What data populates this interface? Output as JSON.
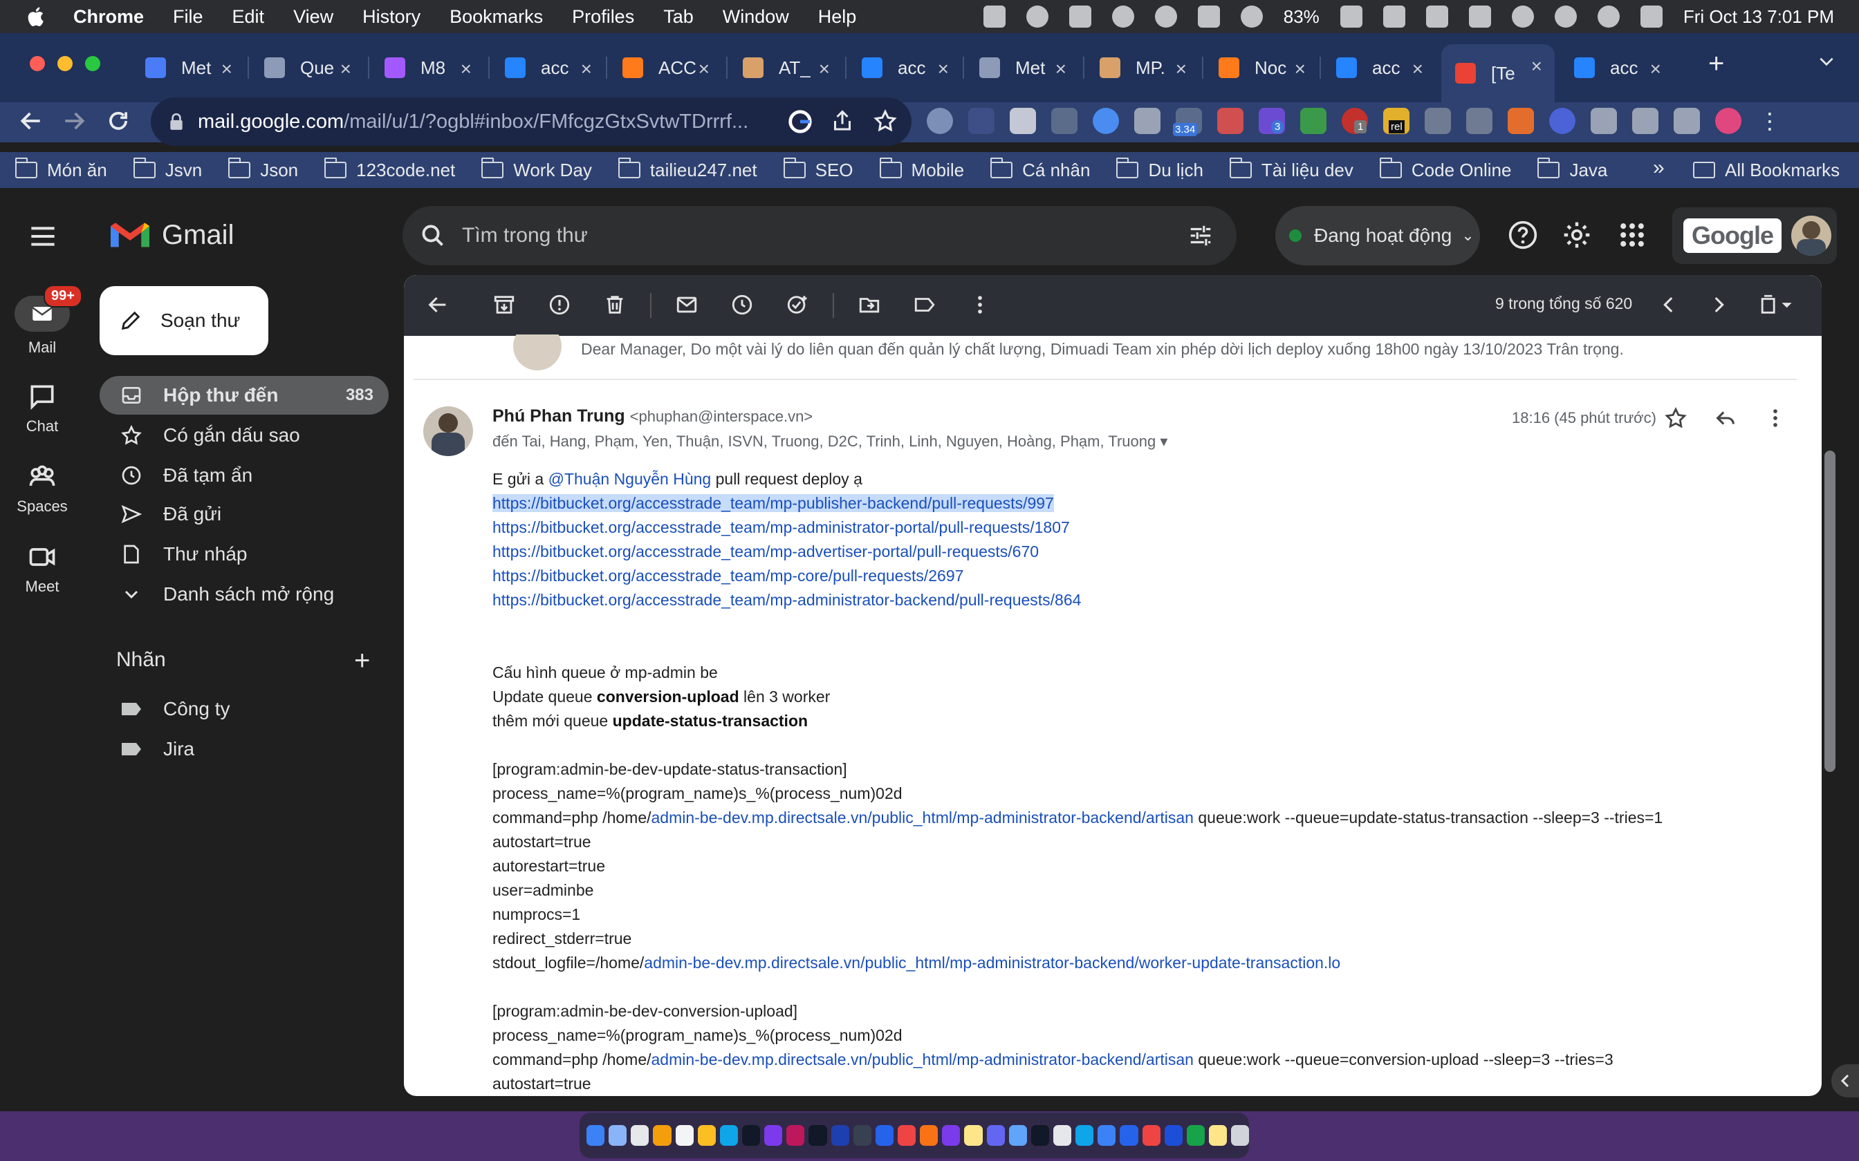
{
  "menubar": {
    "app": "Chrome",
    "items": [
      "File",
      "Edit",
      "View",
      "History",
      "Bookmarks",
      "Profiles",
      "Tab",
      "Window",
      "Help"
    ],
    "battery": "83%",
    "datetime": "Fri Oct 13  7:01 PM"
  },
  "tabs": [
    {
      "title": "Met",
      "color": "#4a7cf7"
    },
    {
      "title": "Que",
      "color": "#8e9bb8"
    },
    {
      "title": "M8",
      "color": "#a259ff"
    },
    {
      "title": "acc",
      "color": "#2684ff"
    },
    {
      "title": "ACC",
      "color": "#ff7a1a"
    },
    {
      "title": "AT_",
      "color": "#d9a06a"
    },
    {
      "title": "acc",
      "color": "#2684ff"
    },
    {
      "title": "Met",
      "color": "#8e9bb8"
    },
    {
      "title": "MP.",
      "color": "#d9a06a"
    },
    {
      "title": "Noc",
      "color": "#ff7a1a"
    },
    {
      "title": "acc",
      "color": "#2684ff"
    },
    {
      "title": "[Te",
      "color": "#ea4335"
    },
    {
      "title": "acc",
      "color": "#2684ff"
    }
  ],
  "omnibox": {
    "host": "mail.google.com",
    "path": "/mail/u/1/?ogbl#inbox/FMfcgzGtxSvtwTDrrrf..."
  },
  "extensions": {
    "badge_count": "3.34",
    "badge_3": "3",
    "badge_1": "1",
    "rel": "rel"
  },
  "bookmarks": [
    "Món ăn",
    "Jsvn",
    "Json",
    "123code.net",
    "Work Day",
    "tailieu247.net",
    "SEO",
    "Mobile",
    "Cá nhân",
    "Du lịch",
    "Tài liệu dev",
    "Code Online",
    "Java"
  ],
  "bookmarks_more": "»",
  "bookmarks_all": "All Bookmarks",
  "rail": {
    "mail": "Mail",
    "mail_badge": "99+",
    "chat": "Chat",
    "spaces": "Spaces",
    "meet": "Meet"
  },
  "gmail": {
    "logo": "Gmail",
    "search_placeholder": "Tìm trong thư",
    "status": "Đang hoạt động",
    "google": "Google"
  },
  "compose": "Soạn thư",
  "nav": [
    {
      "label": "Hộp thư đến",
      "count": "383",
      "icon": "inbox-icon"
    },
    {
      "label": "Có gắn dấu sao",
      "icon": "star-icon"
    },
    {
      "label": "Đã tạm ẩn",
      "icon": "clock-icon"
    },
    {
      "label": "Đã gửi",
      "icon": "send-icon"
    },
    {
      "label": "Thư nháp",
      "icon": "draft-icon"
    },
    {
      "label": "Danh sách mở rộng",
      "icon": "chevron-down-icon"
    }
  ],
  "labels": {
    "heading": "Nhãn",
    "items": [
      "Công ty",
      "Jira"
    ]
  },
  "pager": "9 trong tổng số 620",
  "prev_snippet": "Dear Manager, Do một vài lý do liên quan đến quản lý chất lượng, Dimuadi Team xin phép dời lịch deploy xuống 18h00 ngày 13/10/2023 Trân trọng.",
  "message": {
    "sender_name": "Phú Phan Trung",
    "sender_email": "<phuphan@interspace.vn>",
    "recipients": "đến Tai, Hang, Phạm, Yen, Thuận, ISVN, Truong, D2C, Trinh, Linh, Nguyen, Hoàng, Phạm, Truong",
    "time": "18:16 (45 phút trước)",
    "intro_prefix": "E gửi a ",
    "mention": "@Thuận Nguyễn Hùng",
    "intro_suffix": "  pull request deploy ạ",
    "links": [
      "https://bitbucket.org/accesstrade_team/mp-publisher-backend/pull-requests/997",
      "https://bitbucket.org/accesstrade_team/mp-administrator-portal/pull-requests/1807",
      "https://bitbucket.org/accesstrade_team/mp-advertiser-portal/pull-requests/670",
      "https://bitbucket.org/accesstrade_team/mp-core/pull-requests/2697",
      "https://bitbucket.org/accesstrade_team/mp-administrator-backend/pull-requests/864"
    ],
    "queue_title": "Cấu hình queue ở mp-admin be",
    "q1_prefix": "Update queue ",
    "q1_bold": "conversion-upload",
    "q1_suffix": " lên 3 worker",
    "q2_prefix": "thêm mới queue ",
    "q2_bold": "update-status-transaction",
    "block1_header": "[program:admin-be-dev-update-status-transaction]",
    "process_name": "process_name=%(program_name)s_%(process_num)02d",
    "cmd_prefix": "command=php /home/",
    "cmd_link": "admin-be-dev.mp.directsale.vn/public_html/mp-administrator-backend/artisan",
    "cmd1_suffix": " queue:work --queue=update-status-transaction --sleep=3 --tries=1",
    "autostart": "autostart=true",
    "autorestart": "autorestart=true",
    "user": "user=adminbe",
    "numprocs": "numprocs=1",
    "redirect": "redirect_stderr=true",
    "logfile_prefix": "stdout_logfile=/home/",
    "logfile_link": "admin-be-dev.mp.directsale.vn/public_html/mp-administrator-backend/worker-update-transaction.lo",
    "block2_header": "[program:admin-be-dev-conversion-upload]",
    "cmd2_suffix": " queue:work --queue=conversion-upload --sleep=3 --tries=3"
  }
}
